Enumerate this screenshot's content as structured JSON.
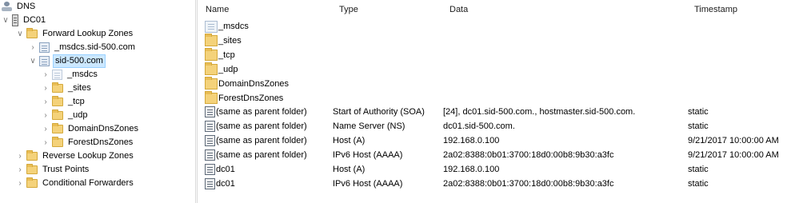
{
  "tree": {
    "root": "DNS",
    "server": "DC01",
    "forward_zones": "Forward Lookup Zones",
    "msdcs_zone": "_msdcs.sid-500.com",
    "selected_zone": "sid-500.com",
    "sub_items": [
      "_msdcs",
      "_sites",
      "_tcp",
      "_udp",
      "DomainDnsZones",
      "ForestDnsZones"
    ],
    "reverse_zones": "Reverse Lookup Zones",
    "trust_points": "Trust Points",
    "conditional_forwarders": "Conditional Forwarders"
  },
  "list": {
    "columns": {
      "name": "Name",
      "type": "Type",
      "data": "Data",
      "timestamp": "Timestamp"
    },
    "rows": [
      {
        "name": "_msdcs",
        "type": "",
        "data": "",
        "timestamp": "",
        "icon": "zone-delegation-icon"
      },
      {
        "name": "_sites",
        "type": "",
        "data": "",
        "timestamp": "",
        "icon": "folder-icon"
      },
      {
        "name": "_tcp",
        "type": "",
        "data": "",
        "timestamp": "",
        "icon": "folder-icon"
      },
      {
        "name": "_udp",
        "type": "",
        "data": "",
        "timestamp": "",
        "icon": "folder-icon"
      },
      {
        "name": "DomainDnsZones",
        "type": "",
        "data": "",
        "timestamp": "",
        "icon": "folder-icon"
      },
      {
        "name": "ForestDnsZones",
        "type": "",
        "data": "",
        "timestamp": "",
        "icon": "folder-icon"
      },
      {
        "name": "(same as parent folder)",
        "type": "Start of Authority (SOA)",
        "data": "[24], dc01.sid-500.com., hostmaster.sid-500.com.",
        "timestamp": "static",
        "icon": "record-icon"
      },
      {
        "name": "(same as parent folder)",
        "type": "Name Server (NS)",
        "data": "dc01.sid-500.com.",
        "timestamp": "static",
        "icon": "record-icon"
      },
      {
        "name": "(same as parent folder)",
        "type": "Host (A)",
        "data": "192.168.0.100",
        "timestamp": "9/21/2017 10:00:00 AM",
        "icon": "record-icon"
      },
      {
        "name": "(same as parent folder)",
        "type": "IPv6 Host (AAAA)",
        "data": "2a02:8388:0b01:3700:18d0:00b8:9b30:a3fc",
        "timestamp": "9/21/2017 10:00:00 AM",
        "icon": "record-icon"
      },
      {
        "name": "dc01",
        "type": "Host (A)",
        "data": "192.168.0.100",
        "timestamp": "static",
        "icon": "record-icon"
      },
      {
        "name": "dc01",
        "type": "IPv6 Host (AAAA)",
        "data": "2a02:8388:0b01:3700:18d0:00b8:9b30:a3fc",
        "timestamp": "static",
        "icon": "record-icon"
      }
    ]
  }
}
